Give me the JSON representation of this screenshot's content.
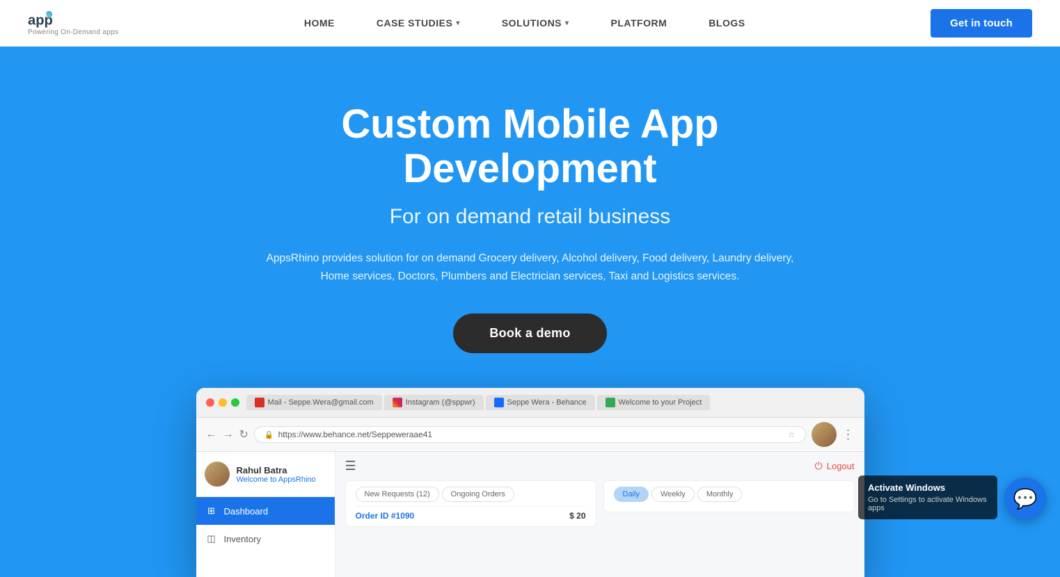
{
  "navbar": {
    "logo_text": "apps",
    "logo_sub": "Powering On-Demand apps",
    "nav_items": [
      {
        "label": "HOME",
        "has_dropdown": false
      },
      {
        "label": "CASE STUDIES",
        "has_dropdown": true
      },
      {
        "label": "SOLUTIONS",
        "has_dropdown": true
      },
      {
        "label": "PLATFORM",
        "has_dropdown": false
      },
      {
        "label": "BLOGS",
        "has_dropdown": false
      }
    ],
    "cta_label": "Get in touch"
  },
  "hero": {
    "title": "Custom Mobile App Development",
    "subtitle": "For on demand retail business",
    "description": "AppsRhino provides solution for on demand Grocery delivery, Alcohol delivery, Food delivery, Laundry delivery, Home services, Doctors, Plumbers and Electrician services, Taxi and Logistics services.",
    "cta_label": "Book a demo"
  },
  "browser": {
    "tabs": [
      {
        "label": "Mail - Seppe.Wera@gmail.com",
        "icon_color": "#d93025"
      },
      {
        "label": "Instagram (@sppwr)",
        "icon_color": "#c13584"
      },
      {
        "label": "Seppe Wera - Behance",
        "icon_color": "#1769ff"
      },
      {
        "label": "Welcome to your Project",
        "icon_color": "#34a853"
      }
    ],
    "address": "https://www.behance.net/Seppeweraae41"
  },
  "dashboard": {
    "user_name": "Rahul Batra",
    "user_welcome": "Welcome to",
    "user_brand": "AppsRhino",
    "logout_label": "Logout",
    "sidebar_items": [
      {
        "label": "Dashboard",
        "active": true,
        "icon": "⊞"
      },
      {
        "label": "Inventory",
        "active": false,
        "icon": "◫"
      }
    ],
    "tabs": [
      {
        "label": "New Requests (12)",
        "active": false
      },
      {
        "label": "Ongoing Orders",
        "active": false
      }
    ],
    "period_tabs": [
      {
        "label": "Daily",
        "active": true
      },
      {
        "label": "Weekly",
        "active": false
      },
      {
        "label": "Monthly",
        "active": false
      }
    ],
    "order_id": "Order ID #1090",
    "order_price": "$ 20"
  },
  "windows_activate": {
    "title": "Activate Windows",
    "subtitle": "Go to Settings to activate Windows apps"
  },
  "chat_widget": {
    "icon": "💬"
  }
}
